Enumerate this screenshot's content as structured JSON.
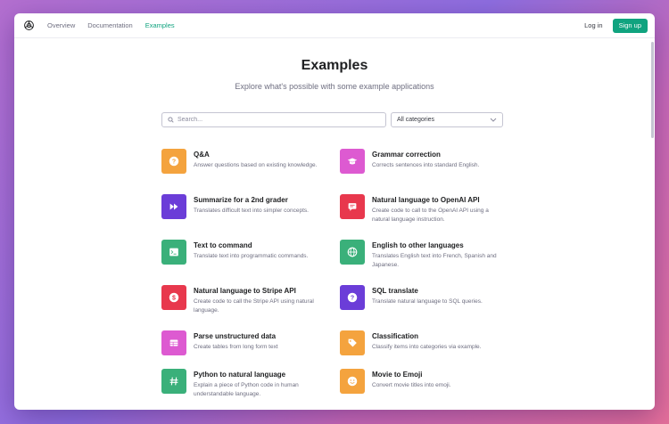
{
  "nav": {
    "links": [
      "Overview",
      "Documentation",
      "Examples"
    ],
    "active_link": "Examples",
    "login_label": "Log in",
    "signup_label": "Sign up"
  },
  "header": {
    "title": "Examples",
    "subtitle": "Explore what's possible with some example applications"
  },
  "search": {
    "placeholder": "Search...",
    "value": ""
  },
  "category_filter": {
    "selected": "All categories"
  },
  "examples": [
    {
      "title": "Q&A",
      "description": "Answer questions based on existing knowledge.",
      "icon": "question-icon",
      "color": "#f4a33e"
    },
    {
      "title": "Grammar correction",
      "description": "Corrects sentences into standard English.",
      "icon": "graduation-cap-icon",
      "color": "#dd5ad1"
    },
    {
      "title": "Summarize for a 2nd grader",
      "description": "Translates difficult text into simpler concepts.",
      "icon": "fast-forward-icon",
      "color": "#6b3dd8"
    },
    {
      "title": "Natural language to OpenAI API",
      "description": "Create code to call to the OpenAI API using a natural language instruction.",
      "icon": "message-icon",
      "color": "#e8384d"
    },
    {
      "title": "Text to command",
      "description": "Translate text into programmatic commands.",
      "icon": "terminal-icon",
      "color": "#3ab07a"
    },
    {
      "title": "English to other languages",
      "description": "Translates English text into French, Spanish and Japanese.",
      "icon": "globe-icon",
      "color": "#3ab07a"
    },
    {
      "title": "Natural language to Stripe API",
      "description": "Create code to call the Stripe API using natural language.",
      "icon": "dollar-icon",
      "color": "#e8384d"
    },
    {
      "title": "SQL translate",
      "description": "Translate natural language to SQL queries.",
      "icon": "question-icon",
      "color": "#6b3dd8"
    },
    {
      "title": "Parse unstructured data",
      "description": "Create tables from long form text",
      "icon": "table-icon",
      "color": "#dd5ad1"
    },
    {
      "title": "Classification",
      "description": "Classify items into categories via example.",
      "icon": "tag-icon",
      "color": "#f4a33e"
    },
    {
      "title": "Python to natural language",
      "description": "Explain a piece of Python code in human understandable language.",
      "icon": "hash-icon",
      "color": "#3ab07a"
    },
    {
      "title": "Movie to Emoji",
      "description": "Convert movie titles into emoji.",
      "icon": "smile-icon",
      "color": "#f4a33e"
    }
  ],
  "colors": {
    "accent": "#10a37f",
    "text": "#202123",
    "muted": "#6e6e80"
  }
}
